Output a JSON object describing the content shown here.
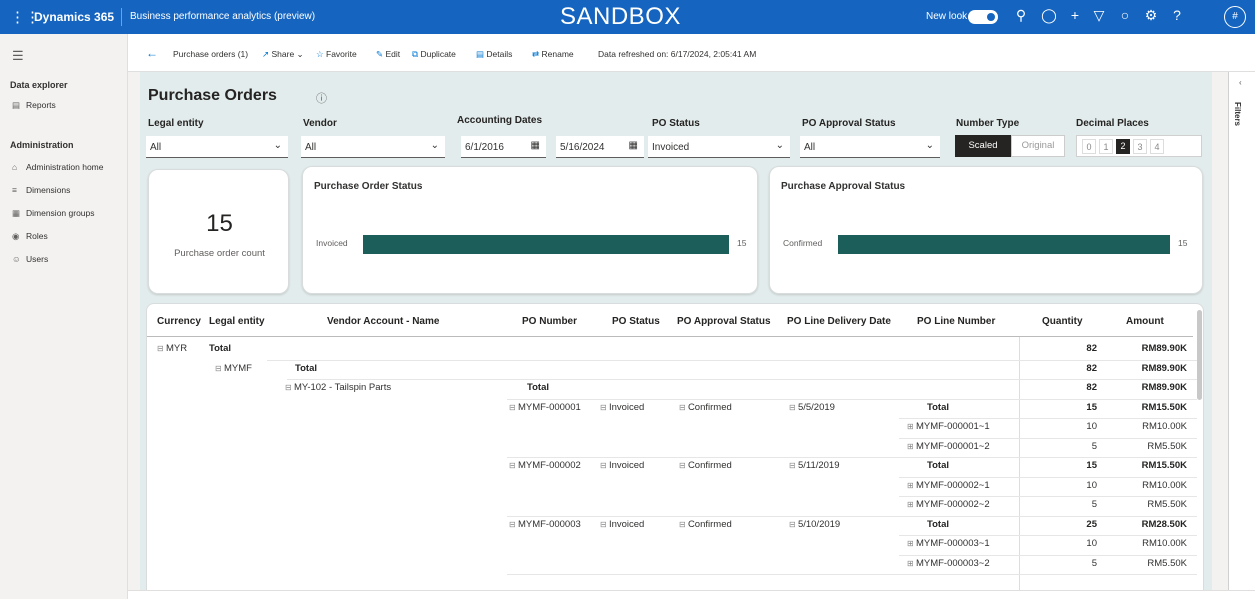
{
  "topbar": {
    "waffle_icon": "waffle-icon",
    "app_name": "Dynamics 365",
    "module": "Business performance analytics (preview)",
    "environment": "SANDBOX",
    "new_look": "New look",
    "avatar": "#",
    "brand_color": "#1565c0"
  },
  "nav": {
    "groups": [
      {
        "label": "Data explorer"
      },
      {
        "label": "Administration"
      }
    ],
    "items": [
      {
        "label": "Reports",
        "icon": "report-icon"
      },
      {
        "label": "Administration home",
        "icon": "home-icon"
      },
      {
        "label": "Dimensions",
        "icon": "list-icon"
      },
      {
        "label": "Dimension groups",
        "icon": "group-icon"
      },
      {
        "label": "Roles",
        "icon": "roles-icon"
      },
      {
        "label": "Users",
        "icon": "user-icon"
      }
    ]
  },
  "cmdbar": {
    "crumb": "Purchase orders (1)",
    "share": "Share",
    "favorite": "Favorite",
    "edit": "Edit",
    "duplicate": "Duplicate",
    "details": "Details",
    "rename": "Rename",
    "refreshed": "Data refreshed on: 6/17/2024, 2:05:41 AM"
  },
  "report": {
    "title": "Purchase Orders",
    "filters": {
      "legal_entity": {
        "label": "Legal entity",
        "value": "All"
      },
      "vendor": {
        "label": "Vendor",
        "value": "All"
      },
      "accounting_dates": {
        "label": "Accounting Dates",
        "from": "6/1/2016",
        "to": "5/16/2024"
      },
      "po_status": {
        "label": "PO Status",
        "value": "Invoiced"
      },
      "po_approval": {
        "label": "PO Approval Status",
        "value": "All"
      },
      "number_type": {
        "label": "Number Type",
        "options": [
          "Scaled",
          "Original"
        ],
        "selected": "Scaled"
      },
      "decimal_places": {
        "label": "Decimal Places",
        "options": [
          "0",
          "1",
          "2",
          "3",
          "4"
        ],
        "selected": "2"
      }
    },
    "kpi": {
      "value": "15",
      "label": "Purchase order count"
    },
    "status_chart": {
      "title": "Purchase Order Status",
      "category": "Invoiced",
      "value": 15,
      "max": 15,
      "color": "#1b5e5a"
    },
    "approval_chart": {
      "title": "Purchase Approval Status",
      "category": "Confirmed",
      "value": 15,
      "max": 15,
      "color": "#1b5e5a"
    }
  },
  "table": {
    "headers": [
      "Currency",
      "Legal entity",
      "Vendor Account - Name",
      "PO Number",
      "PO Status",
      "PO Approval Status",
      "PO Line Delivery Date",
      "PO Line Number",
      "Quantity",
      "Amount"
    ],
    "currency": "MYR",
    "legal_entity": "MYMF",
    "vendor": "MY-102 - Tailspin Parts",
    "total_label": "Total",
    "totals": {
      "quantity": "82",
      "amount": "RM89.90K"
    },
    "orders": [
      {
        "po": "MYMF-000001",
        "status": "Invoiced",
        "approval": "Confirmed",
        "date": "5/5/2019",
        "qty": "15",
        "amount": "RM15.50K",
        "lines": [
          {
            "line": "MYMF-000001~1",
            "qty": "10",
            "amount": "RM10.00K"
          },
          {
            "line": "MYMF-000001~2",
            "qty": "5",
            "amount": "RM5.50K"
          }
        ]
      },
      {
        "po": "MYMF-000002",
        "status": "Invoiced",
        "approval": "Confirmed",
        "date": "5/11/2019",
        "qty": "15",
        "amount": "RM15.50K",
        "lines": [
          {
            "line": "MYMF-000002~1",
            "qty": "10",
            "amount": "RM10.00K"
          },
          {
            "line": "MYMF-000002~2",
            "qty": "5",
            "amount": "RM5.50K"
          }
        ]
      },
      {
        "po": "MYMF-000003",
        "status": "Invoiced",
        "approval": "Confirmed",
        "date": "5/10/2019",
        "qty": "25",
        "amount": "RM28.50K",
        "lines": [
          {
            "line": "MYMF-000003~1",
            "qty": "10",
            "amount": "RM10.00K"
          },
          {
            "line": "MYMF-000003~2",
            "qty": "5",
            "amount": "RM5.50K"
          }
        ]
      }
    ]
  },
  "right_panel": {
    "filters_label": "Filters"
  }
}
